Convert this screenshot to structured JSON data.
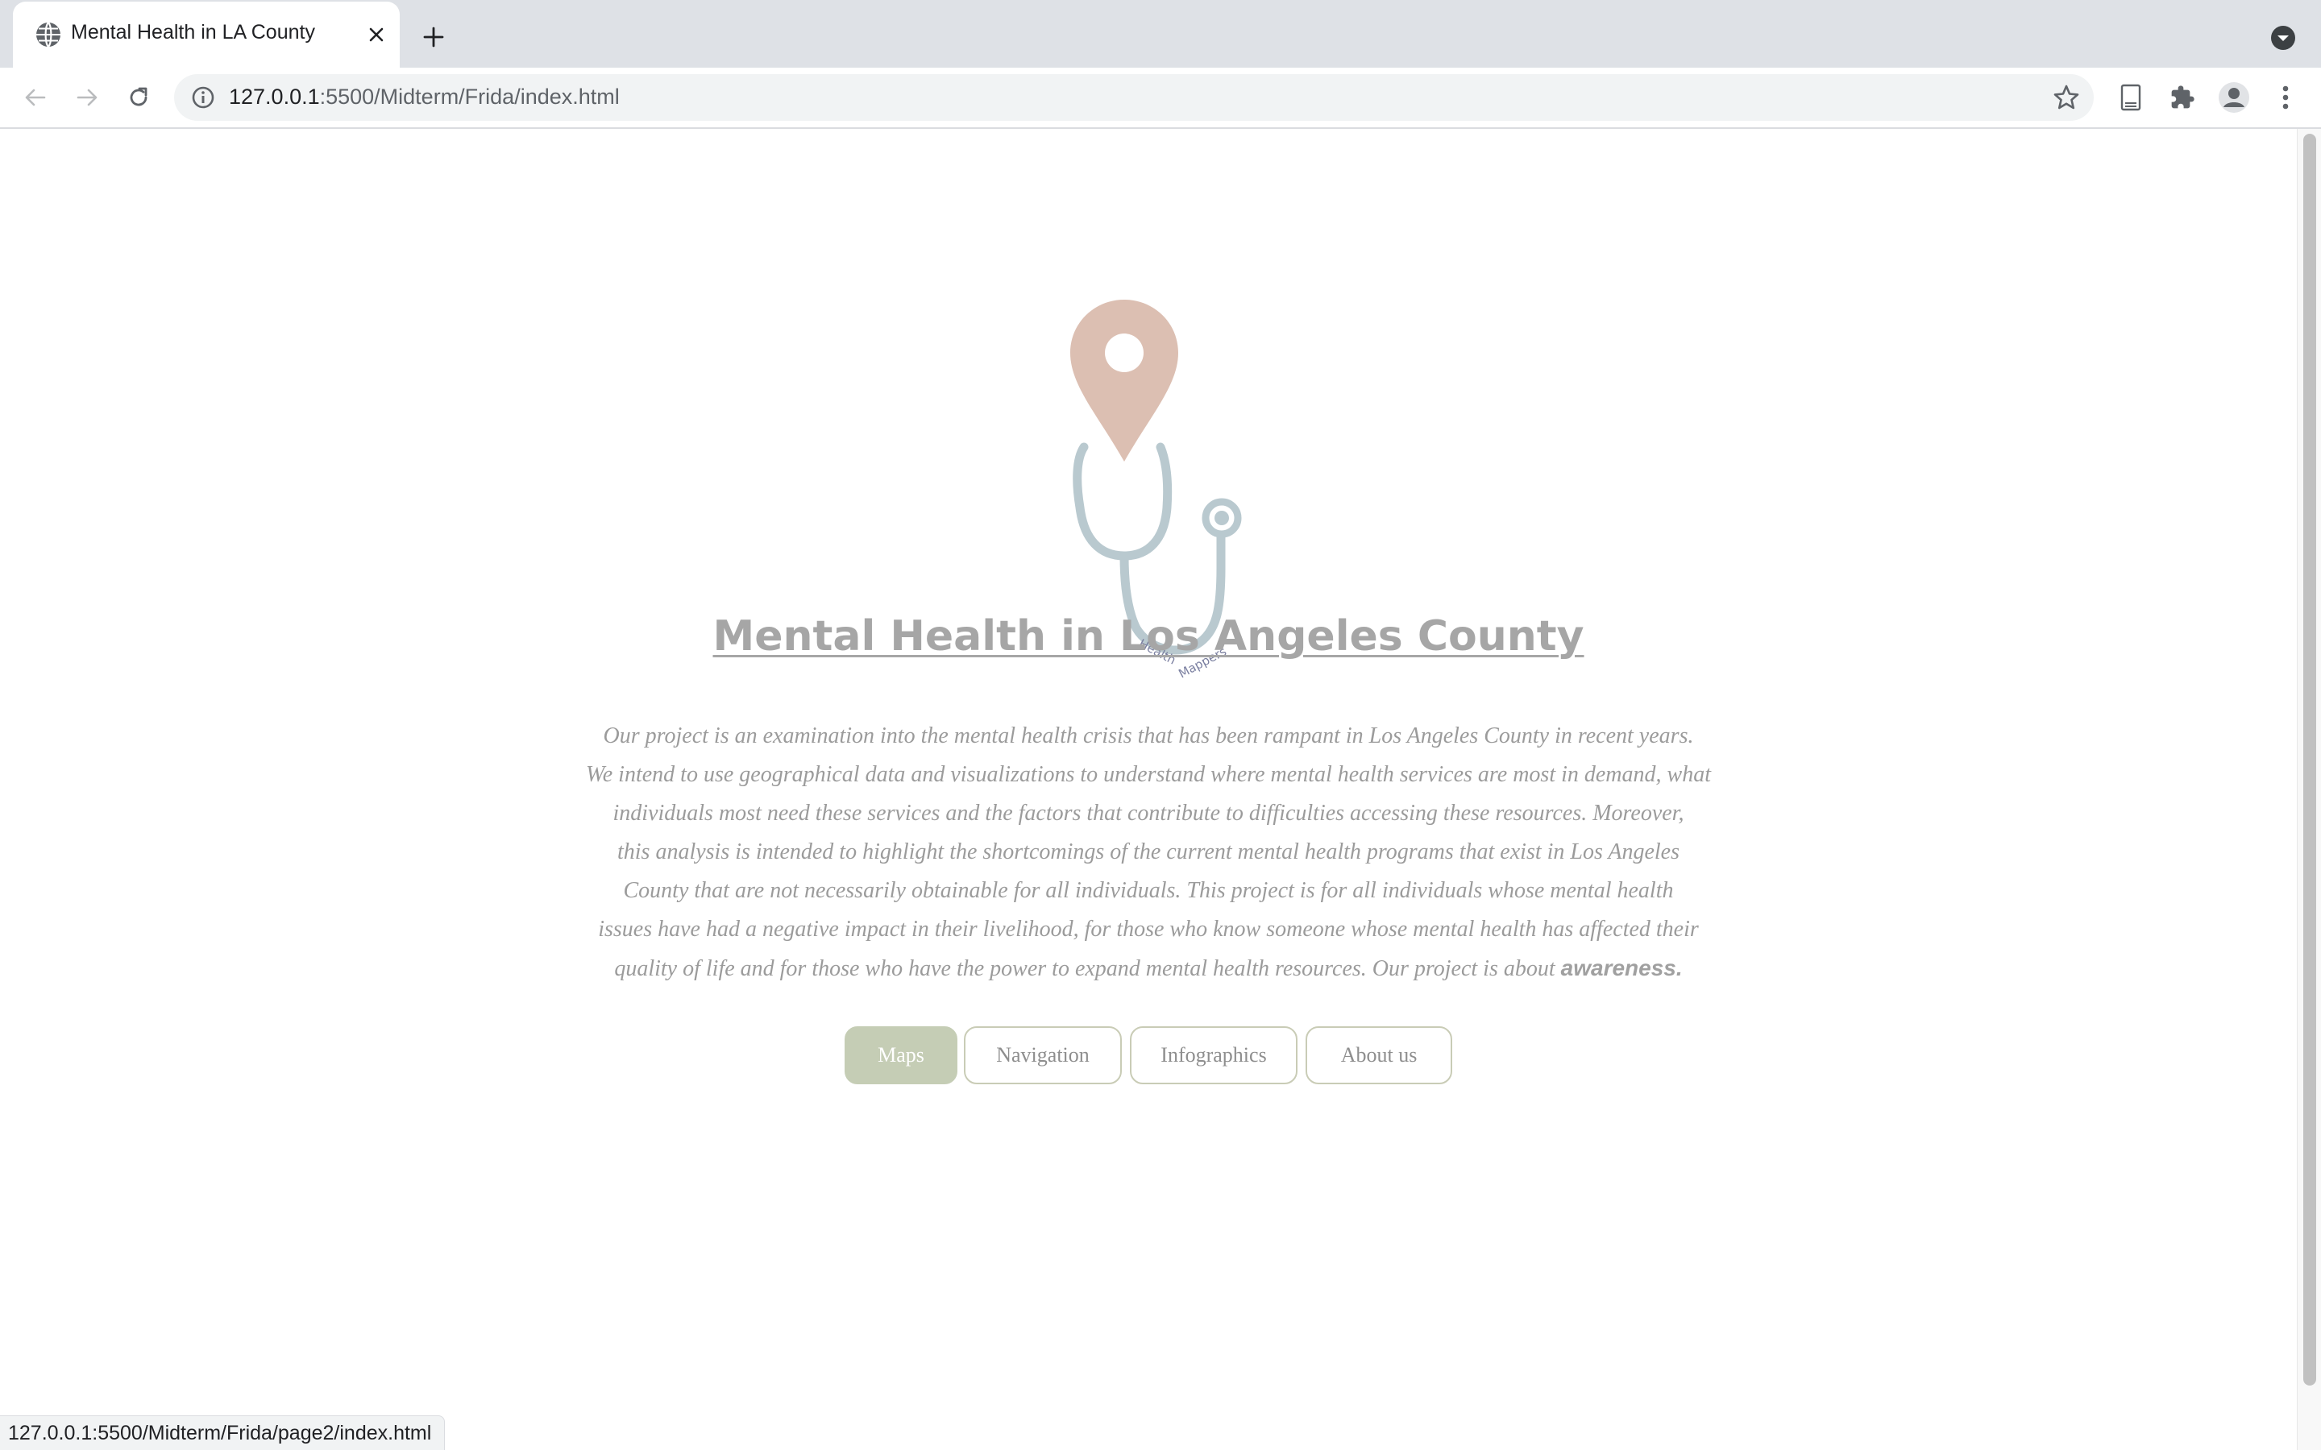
{
  "browser": {
    "tab_title": "Mental Health in LA County",
    "url_host": "127.0.0.1",
    "url_rest": ":5500/Midterm/Frida/index.html",
    "status_url": "127.0.0.1:5500/Midterm/Frida/page2/index.html"
  },
  "logo": {
    "text_left": "Health",
    "text_right": "Mappers"
  },
  "page": {
    "title": "Mental Health in Los Angeles County",
    "intro_lines": [
      "Our project is an examination into the mental health crisis that has been rampant in Los Angeles County in recent years.",
      "We intend to use geographical data and visualizations to understand where mental health services are most in demand, what",
      "individuals most need these services and the factors that contribute to difficulties accessing these resources. Moreover,",
      "this analysis is intended to highlight the shortcomings of the current mental health programs that exist in Los Angeles",
      "County that are not necessarily obtainable for all individuals. This project is for all individuals whose mental health",
      "issues have had a negative impact in their livelihood, for those who know someone whose mental health has affected their",
      "quality of life and for those who have the power to expand mental health resources. Our project is about"
    ],
    "intro_emphasis": "awareness."
  },
  "nav": [
    {
      "label": "Maps",
      "active": true
    },
    {
      "label": "Navigation",
      "active": false
    },
    {
      "label": "Infographics",
      "active": false
    },
    {
      "label": "About us",
      "active": false
    }
  ],
  "colors": {
    "pin": "#dcbfb2",
    "stethoscope": "#b9c9cf",
    "logo_text": "#7a7fa0",
    "title": "#a6a6a6",
    "active_button": "#c5cdb5"
  }
}
